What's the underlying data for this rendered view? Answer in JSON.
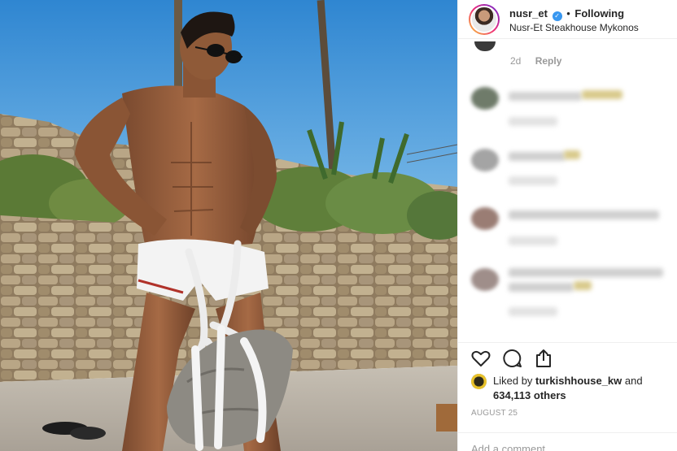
{
  "post": {
    "username": "nusr_et",
    "verified_icon": "verified-badge-icon",
    "separator": "•",
    "follow_status": "Following",
    "location": "Nusr-Et Steakhouse Mykonos"
  },
  "thread": {
    "first_comment_age": "2d",
    "reply_label": "Reply"
  },
  "actions": {
    "like_icon": "heart-icon",
    "comment_icon": "speech-bubble-icon",
    "share_icon": "share-icon",
    "liked_by_prefix": "Liked by",
    "liked_by_user": "turkishhouse_kw",
    "liked_by_and": "and",
    "others_count": "634,113 others",
    "date": "AUGUST 25"
  },
  "composer": {
    "placeholder": "Add a comment..."
  },
  "colors": {
    "verified_blue": "#3897f0",
    "divider": "#efefef",
    "muted_text": "#999999",
    "sky": "#4fa3dc"
  }
}
